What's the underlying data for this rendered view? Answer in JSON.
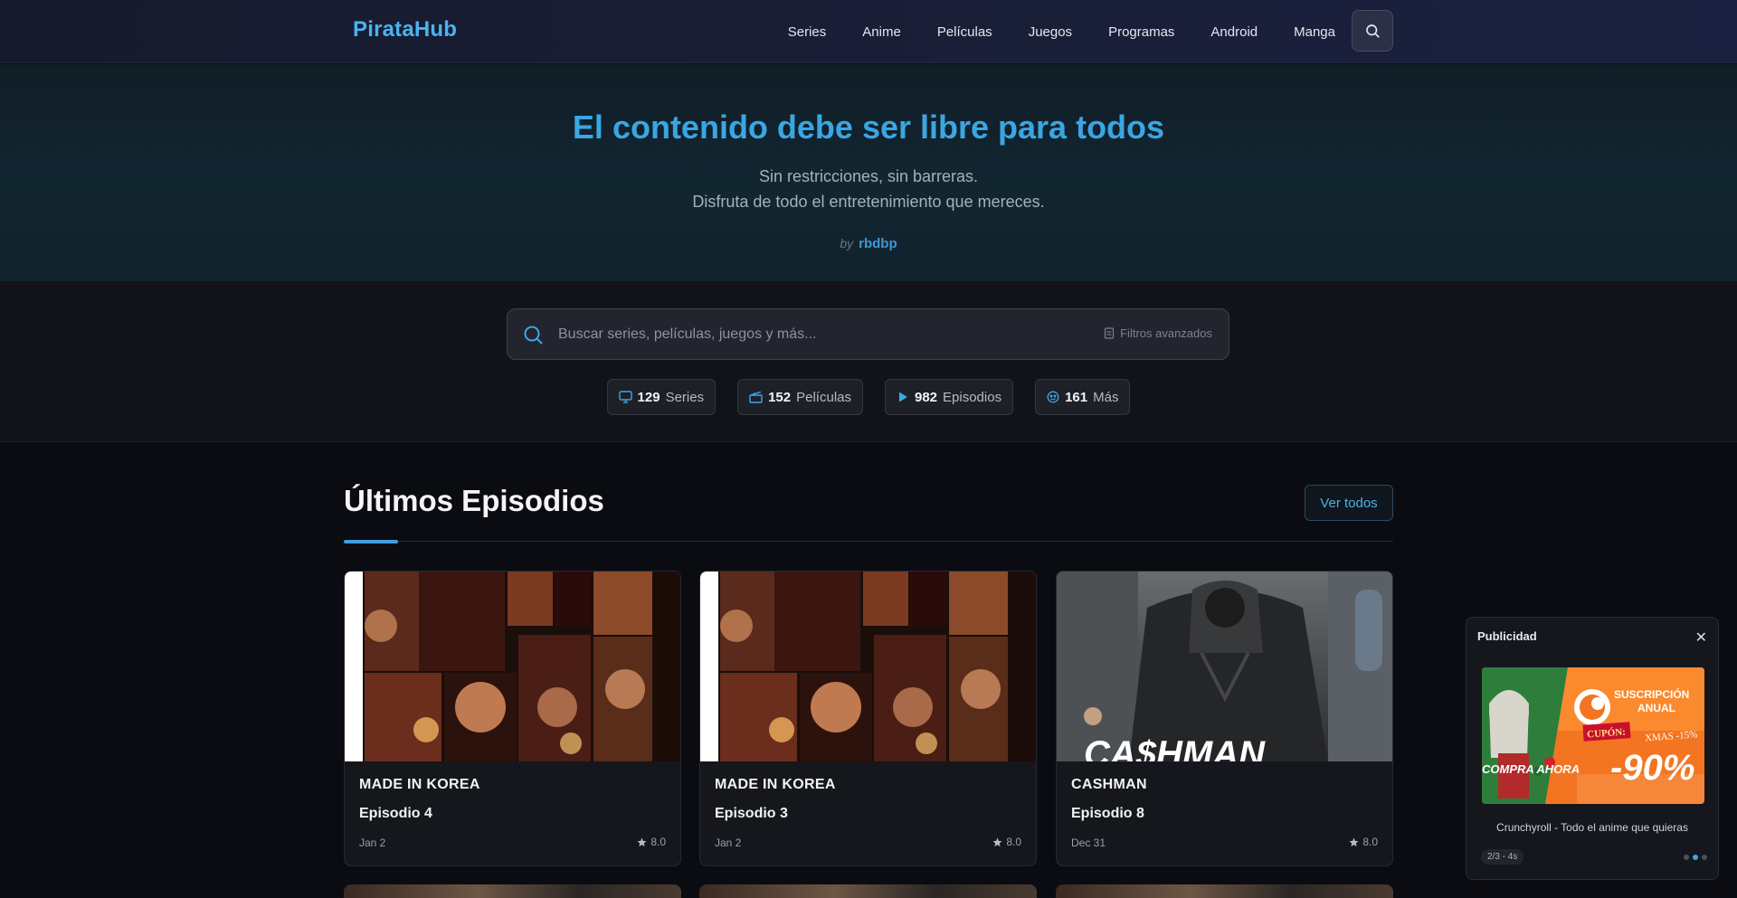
{
  "nav": {
    "logo": "PirataHub",
    "links": [
      "Series",
      "Anime",
      "Películas",
      "Juegos",
      "Programas",
      "Android",
      "Manga"
    ]
  },
  "hero": {
    "title": "El contenido debe ser libre para todos",
    "line1": "Sin restricciones, sin barreras.",
    "line2": "Disfruta de todo el entretenimiento que mereces.",
    "by": "by",
    "author": "rbdbp"
  },
  "search": {
    "placeholder": "Buscar series, películas, juegos y más...",
    "advanced": "Filtros avanzados"
  },
  "stats": [
    {
      "icon": "tv-icon",
      "num": "129",
      "label": "Series"
    },
    {
      "icon": "film-icon",
      "num": "152",
      "label": "Películas"
    },
    {
      "icon": "play-icon",
      "num": "982",
      "label": "Episodios"
    },
    {
      "icon": "globe-icon",
      "num": "161",
      "label": "Más"
    }
  ],
  "section": {
    "title": "Últimos Episodios",
    "view_all": "Ver todos"
  },
  "cards": [
    {
      "show": "MADE IN KOREA",
      "episode": "Episodio 4",
      "date": "Jan 2",
      "rating": "8.0"
    },
    {
      "show": "MADE IN KOREA",
      "episode": "Episodio 3",
      "date": "Jan 2",
      "rating": "8.0"
    },
    {
      "show": "CASHMAN",
      "episode": "Episodio 8",
      "date": "Dec 31",
      "rating": "8.0"
    }
  ],
  "ad": {
    "title": "Publicidad",
    "close": "✕",
    "caption": "Crunchyroll - Todo el anime que quieras",
    "counter": "2/3 - 4s",
    "banner": {
      "line1": "SUSCRIPCIÓN",
      "line2": "ANUAL",
      "coupon": "CUPÓN:",
      "code": "XMAS -15%",
      "cta": "COMPRA AHORA",
      "discount": "-90%"
    }
  },
  "colors": {
    "accent": "#3aa6e2",
    "background": "#0b0c11"
  }
}
